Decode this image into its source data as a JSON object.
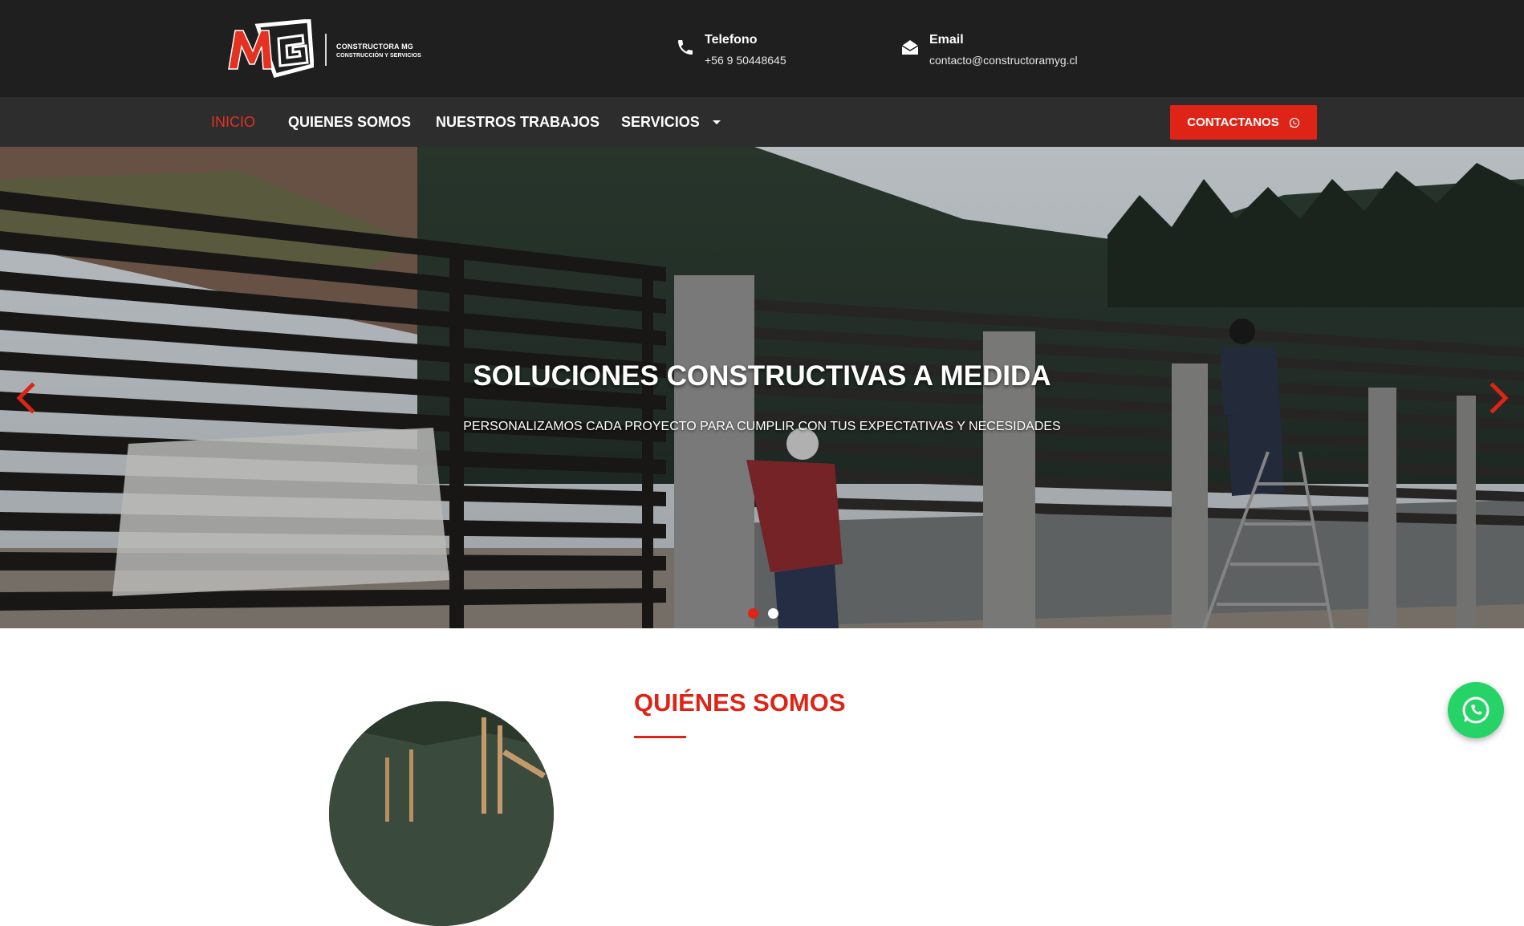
{
  "brand": {
    "logo_letters": "MG",
    "name_line1": "CONSTRUCTORA MG",
    "name_line2": "CONSTRUCCIÓN Y SERVICIOS"
  },
  "contacts": {
    "phone": {
      "label": "Telefono",
      "value": "+56 9 50448645",
      "icon": "phone-icon"
    },
    "email": {
      "label": "Email",
      "value": "contacto@constructoramyg.cl",
      "icon": "envelope-open-icon"
    }
  },
  "nav": {
    "items": [
      {
        "label": "INICIO",
        "active": true
      },
      {
        "label": "QUIENES SOMOS",
        "active": false
      },
      {
        "label": "NUESTROS TRABAJOS",
        "active": false
      },
      {
        "label": "SERVICIOS",
        "active": false,
        "has_dropdown": true
      }
    ],
    "cta_label": "CONTACTANOS",
    "cta_icon": "whatsapp-icon"
  },
  "hero": {
    "title": "SOLUCIONES CONSTRUCTIVAS A MEDIDA",
    "subtitle": "PERSONALIZAMOS CADA PROYECTO PARA CUMPLIR CON TUS EXPECTATIVAS Y NECESIDADES",
    "slide_count": 2,
    "active_slide": 1
  },
  "about": {
    "title": "QUIÉNES SOMOS"
  },
  "colors": {
    "accent": "#dd2416",
    "topbar": "#1f1f1f",
    "navbar": "#2d2d2d",
    "whatsapp": "#25d366"
  }
}
